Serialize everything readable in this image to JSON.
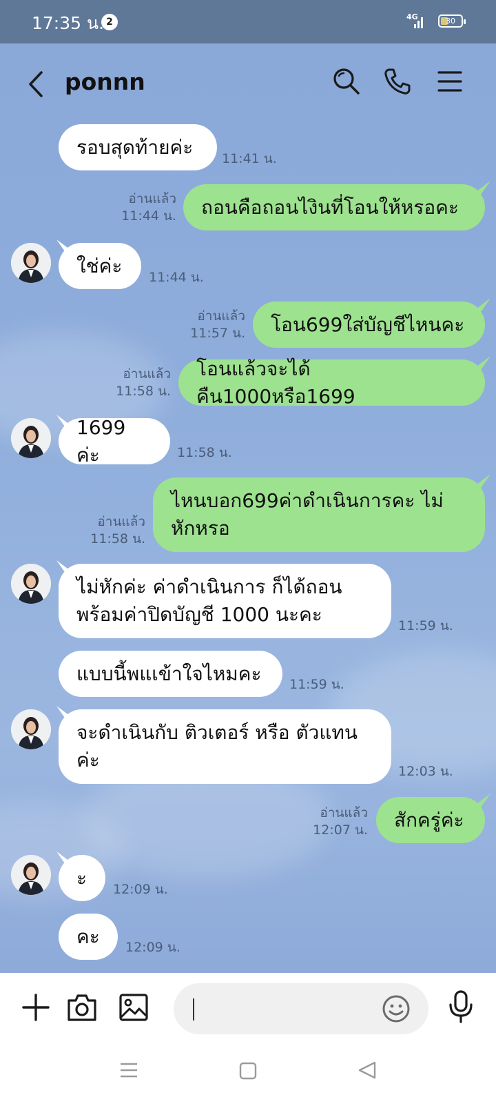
{
  "status_bar": {
    "time": "17:35 น.",
    "notification_count": "2",
    "network": "4G",
    "battery_level": "30"
  },
  "header": {
    "title": "ponnn",
    "icons": [
      "back-icon",
      "search-icon",
      "phone-icon",
      "menu-icon"
    ]
  },
  "messages": [
    {
      "side": "in",
      "avatar": false,
      "text": "รอบสุดท้ายค่ะ",
      "time": "11:41 น."
    },
    {
      "side": "out",
      "read": "อ่านแล้ว",
      "text": "ถอนคือถอนไงินที่โอนให้หรอคะ",
      "time": "11:44 น."
    },
    {
      "side": "in",
      "avatar": true,
      "text": "ใช่ค่ะ",
      "time": "11:44 น."
    },
    {
      "side": "out",
      "read": "อ่านแล้ว",
      "text": "โอน699ใส่บัญชีไหนคะ",
      "time": "11:57 น."
    },
    {
      "side": "out",
      "read": "อ่านแล้ว",
      "text": "โอนแล้วจะได้คืน1000หรือ1699",
      "time": "11:58 น."
    },
    {
      "side": "in",
      "avatar": true,
      "text": "1699 ค่ะ",
      "time": "11:58 น."
    },
    {
      "side": "out",
      "read": "อ่านแล้ว",
      "text_line1": "ไหนบอก699ค่าดำเนินการคะ ไม่",
      "text_line2": "หักหรอ",
      "time": "11:58 น."
    },
    {
      "side": "in",
      "avatar": true,
      "text_line1": "ไม่หักค่ะ ค่าดำเนินการ ก็ได้ถอน",
      "text_line2": "พร้อมค่าปิดบัญชี 1000 นะคะ",
      "time": "11:59 น."
    },
    {
      "side": "in",
      "avatar": false,
      "text": "แบบนี้พแเข้าใจไหมคะ",
      "time": "11:59 น."
    },
    {
      "side": "in",
      "avatar": true,
      "text_line1": "จะดำเนินกับ ติวเตอร์ หรือ ตัวแทน",
      "text_line2": "ค่ะ",
      "time": "12:03 น."
    },
    {
      "side": "out",
      "read": "อ่านแล้ว",
      "text": "สักครู่ค่ะ",
      "time": "12:07 น."
    },
    {
      "side": "in",
      "avatar": true,
      "text": "ะ",
      "time": "12:09 น."
    },
    {
      "side": "in",
      "avatar": false,
      "text": "คะ",
      "time": "12:09 น."
    }
  ],
  "input_bar": {
    "icons": [
      "plus-icon",
      "camera-icon",
      "image-icon",
      "emoji-icon",
      "microphone-icon"
    ],
    "placeholder": ""
  },
  "nav_bar": {
    "icons": [
      "recent-apps-icon",
      "home-icon",
      "back-nav-icon"
    ]
  },
  "colors": {
    "status_bar": "#5f7898",
    "chat_background": "#8eaad9",
    "outgoing_bubble": "#9de28f",
    "incoming_bubble": "#ffffff"
  }
}
